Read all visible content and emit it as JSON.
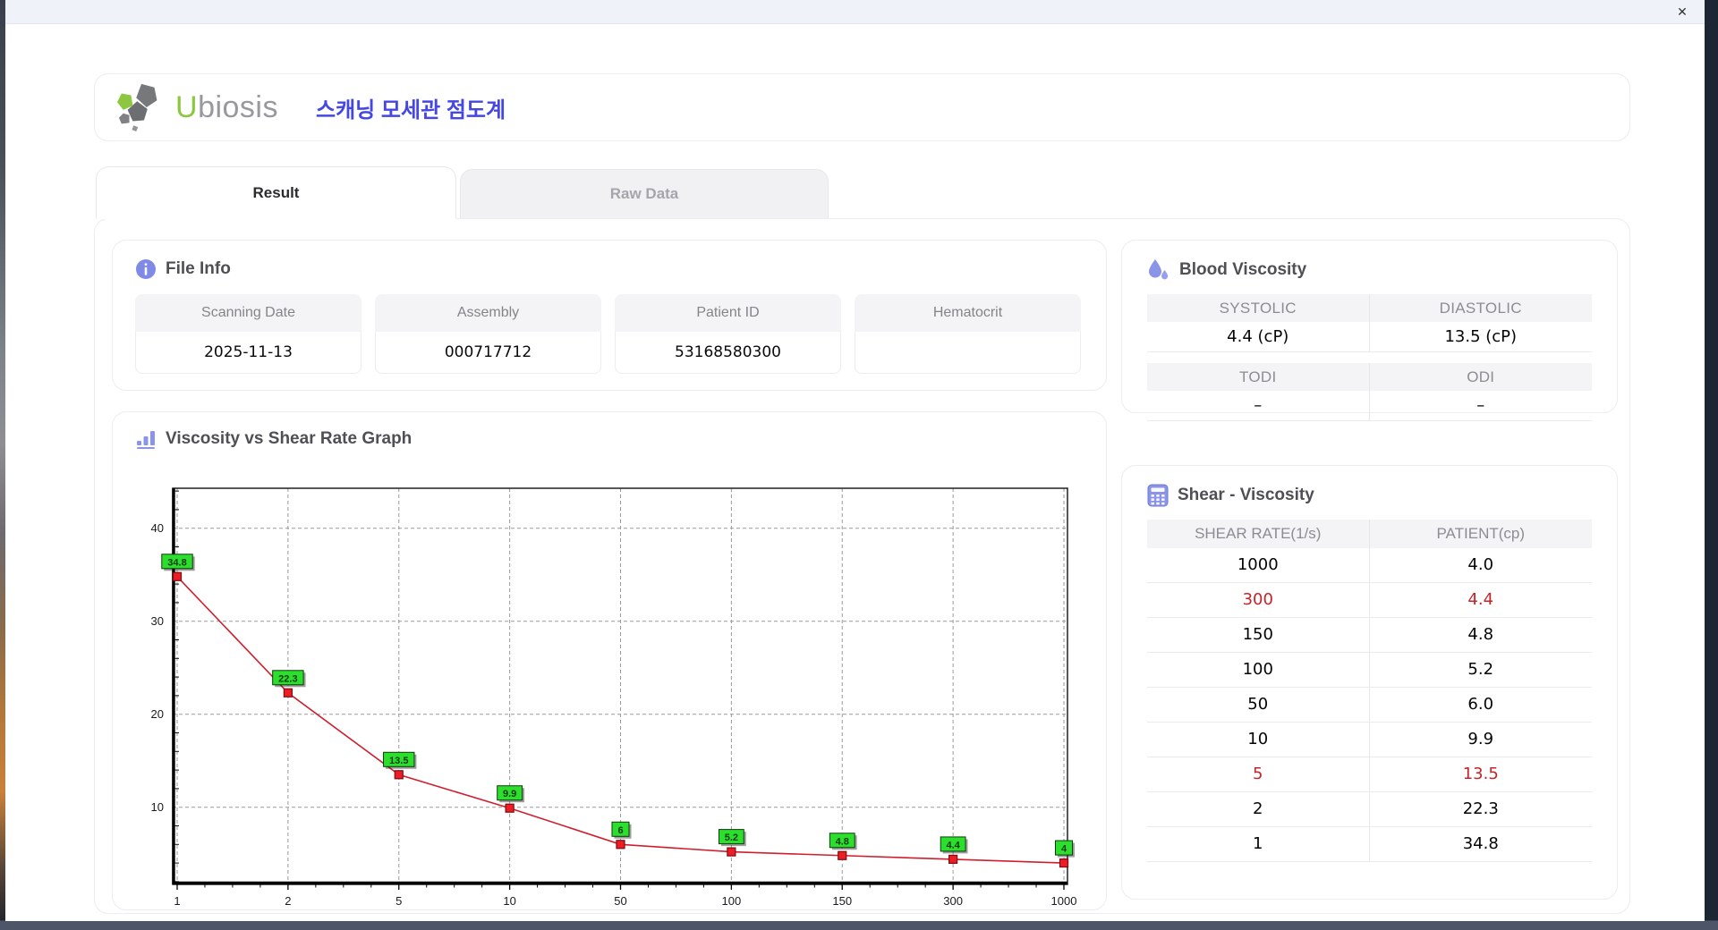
{
  "window": {
    "close_label": "✕"
  },
  "header": {
    "logo": {
      "u": "U",
      "rest": "biosis"
    },
    "title": "스캐닝 모세관 점도계"
  },
  "tabs": [
    {
      "label": "Result",
      "active": true
    },
    {
      "label": "Raw Data",
      "active": false
    }
  ],
  "file_info": {
    "title": "File Info",
    "fields": [
      {
        "label": "Scanning Date",
        "value": "2025-11-13"
      },
      {
        "label": "Assembly",
        "value": "000717712"
      },
      {
        "label": "Patient ID",
        "value": "53168580300"
      },
      {
        "label": "Hematocrit",
        "value": ""
      }
    ]
  },
  "graph_section": {
    "title": "Viscosity vs Shear Rate Graph"
  },
  "blood_viscosity": {
    "title": "Blood Viscosity",
    "tables": [
      {
        "headers": [
          "SYSTOLIC",
          "DIASTOLIC"
        ],
        "values": [
          "4.4 (cP)",
          "13.5 (cP)"
        ]
      },
      {
        "headers": [
          "TODI",
          "ODI"
        ],
        "values": [
          "–",
          "–"
        ]
      }
    ]
  },
  "shear_viscosity": {
    "title": "Shear - Viscosity",
    "columns": [
      "SHEAR RATE(1/s)",
      "PATIENT(cp)"
    ],
    "rows": [
      {
        "shear": "1000",
        "patient": "4.0",
        "highlight": false
      },
      {
        "shear": "300",
        "patient": "4.4",
        "highlight": true
      },
      {
        "shear": "150",
        "patient": "4.8",
        "highlight": false
      },
      {
        "shear": "100",
        "patient": "5.2",
        "highlight": false
      },
      {
        "shear": "50",
        "patient": "6.0",
        "highlight": false
      },
      {
        "shear": "10",
        "patient": "9.9",
        "highlight": false
      },
      {
        "shear": "5",
        "patient": "13.5",
        "highlight": true
      },
      {
        "shear": "2",
        "patient": "22.3",
        "highlight": false
      },
      {
        "shear": "1",
        "patient": "34.8",
        "highlight": false
      }
    ]
  },
  "chart_data": {
    "type": "line",
    "title": "Viscosity vs Shear Rate Graph",
    "x_scale": "categorical",
    "categories": [
      "1",
      "2",
      "5",
      "10",
      "50",
      "100",
      "150",
      "300",
      "1000"
    ],
    "values": [
      34.8,
      22.3,
      13.5,
      9.9,
      6,
      5.2,
      4.8,
      4.4,
      4
    ],
    "point_labels": [
      "34.8",
      "22.3",
      "13.5",
      "9.9",
      "6",
      "5.2",
      "4.8",
      "4.4",
      "4"
    ],
    "xlabel": "",
    "ylabel": "",
    "yticks": [
      10,
      20,
      30,
      40
    ],
    "ylim": [
      1.7,
      44.3
    ],
    "grid": true,
    "legend": "none",
    "line_color": "#cf1f2e",
    "marker_color": "#ee1c25",
    "marker_border": "#7d0d12",
    "label_bg": "#2ddf2d",
    "label_border": "#0b3b0b"
  },
  "colors": {
    "accent_purple": "#8b94e8",
    "title_blue": "#4447e2",
    "logo_green": "#8dc63f",
    "logo_gray": "#97999c",
    "highlight_red": "#c42428"
  }
}
